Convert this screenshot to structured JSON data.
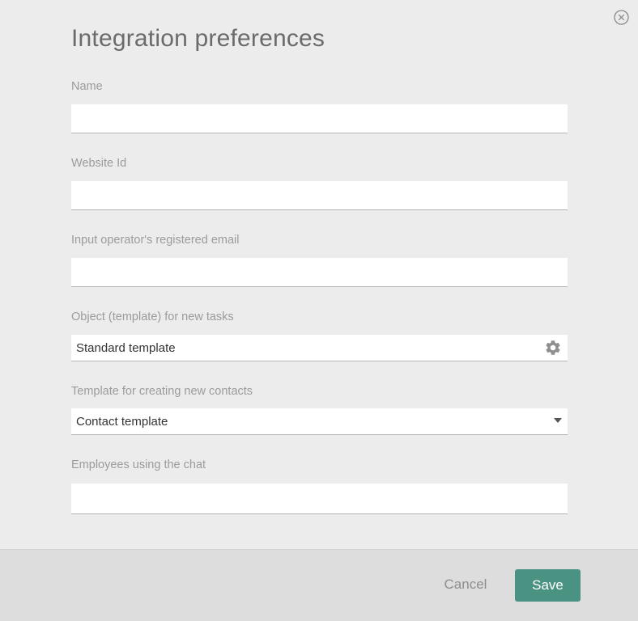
{
  "dialog": {
    "title": "Integration preferences",
    "close_icon": "close-circle-icon"
  },
  "form": {
    "name": {
      "label": "Name",
      "value": "",
      "placeholder": ""
    },
    "website_id": {
      "label": "Website Id",
      "value": "",
      "placeholder": ""
    },
    "operator_email": {
      "label": "Input operator's registered email",
      "value": "",
      "placeholder": ""
    },
    "task_template": {
      "label": "Object (template) for new tasks",
      "value": "Standard template",
      "icon": "gear-icon"
    },
    "contact_template": {
      "label": "Template for creating new contacts",
      "value": "Contact template",
      "icon": "chevron-down-icon"
    },
    "chat_employees": {
      "label": "Employees using the chat",
      "value": "",
      "placeholder": ""
    }
  },
  "footer": {
    "cancel_label": "Cancel",
    "save_label": "Save"
  },
  "colors": {
    "accent": "#4a9383",
    "background": "#ececec",
    "footer_background": "#dddddd",
    "label_text": "#9b9b9b",
    "title_text": "#6b6b6b"
  }
}
